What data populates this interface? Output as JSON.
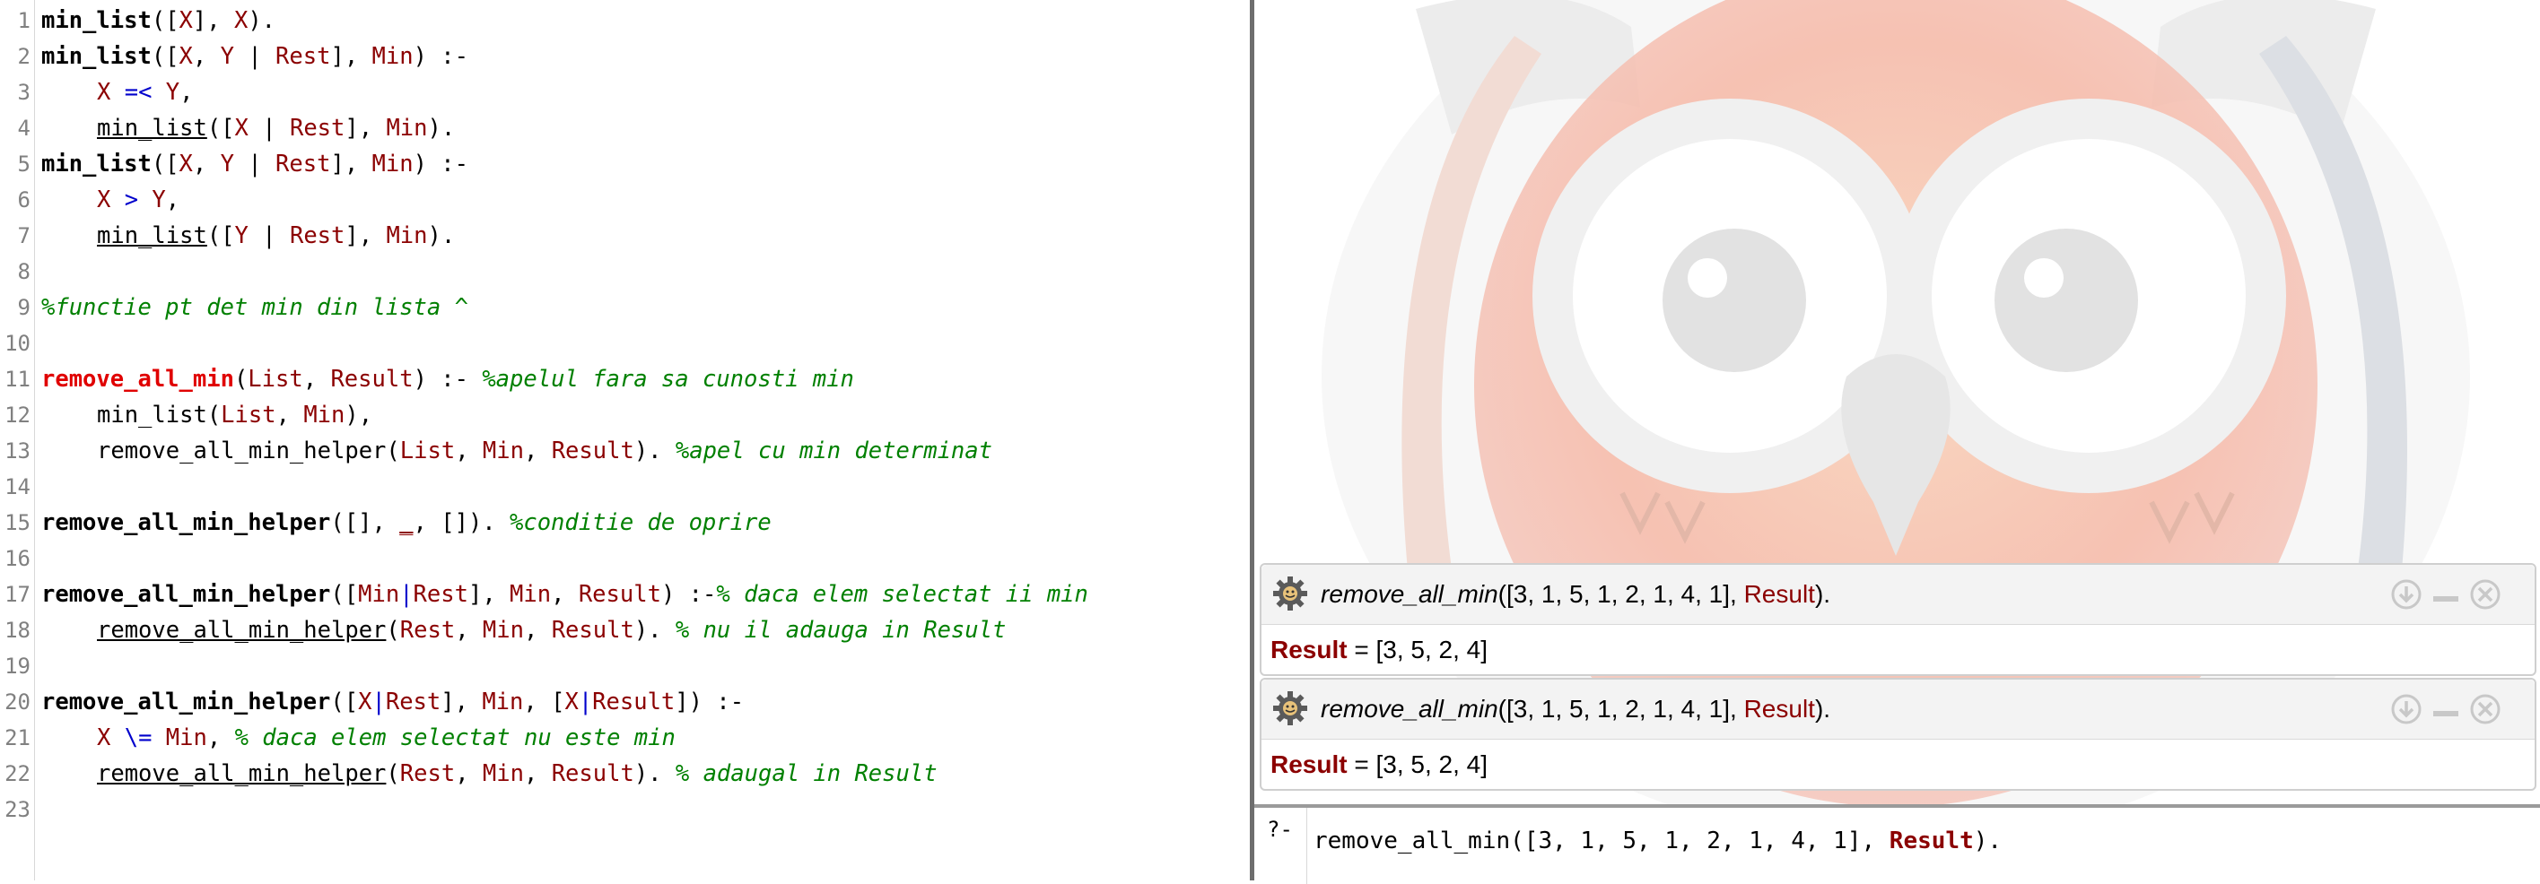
{
  "editor": {
    "line_numbers": [
      "1",
      "2",
      "3",
      "4",
      "5",
      "6",
      "7",
      "8",
      "9",
      "10",
      "11",
      "12",
      "13",
      "14",
      "15",
      "16",
      "17",
      "18",
      "19",
      "20",
      "21",
      "22",
      "23"
    ],
    "lines": {
      "l1": {
        "a": "min_list",
        "b": "([",
        "c": "X",
        "d": "], ",
        "e": "X",
        "f": ")."
      },
      "l2": {
        "a": "min_list",
        "b": "([",
        "c": "X",
        "d": ", ",
        "e": "Y",
        "f": " | ",
        "g": "Rest",
        "h": "], ",
        "i": "Min",
        "j": ") :-"
      },
      "l3": {
        "a": "X",
        "b": " =< ",
        "c": "Y",
        "d": ","
      },
      "l4": {
        "a": "min_list",
        "b": "([",
        "c": "X",
        "d": " | ",
        "e": "Rest",
        "f": "], ",
        "g": "Min",
        "h": ")."
      },
      "l5": {
        "a": "min_list",
        "b": "([",
        "c": "X",
        "d": ", ",
        "e": "Y",
        "f": " | ",
        "g": "Rest",
        "h": "], ",
        "i": "Min",
        "j": ") :-"
      },
      "l6": {
        "a": "X",
        "b": " > ",
        "c": "Y",
        "d": ","
      },
      "l7": {
        "a": "min_list",
        "b": "([",
        "c": "Y",
        "d": " | ",
        "e": "Rest",
        "f": "], ",
        "g": "Min",
        "h": ")."
      },
      "l9": {
        "a": "%functie pt det min din lista ^"
      },
      "l11": {
        "a": "remove_all_min",
        "b": "(",
        "c": "List",
        "d": ", ",
        "e": "Result",
        "f": ") :- ",
        "g": "%apelul fara sa cunosti min"
      },
      "l12": {
        "a": "min_list(",
        "b": "List",
        "c": ", ",
        "d": "Min",
        "e": "),"
      },
      "l13": {
        "a": "remove_all_min_helper(",
        "b": "List",
        "c": ", ",
        "d": "Min",
        "e": ", ",
        "f": "Result",
        "g": "). ",
        "h": "%apel cu min determinat"
      },
      "l15": {
        "a": "remove_all_min_helper",
        "b": "([], ",
        "c": "_",
        "d": ", []). ",
        "e": "%conditie de oprire"
      },
      "l17": {
        "a": "remove_all_min_helper",
        "b": "([",
        "c": "Min",
        "d": "|",
        "e": "Rest",
        "f": "], ",
        "g": "Min",
        "h": ", ",
        "i": "Result",
        "j": ") :-",
        "k": "% daca elem selectat ii min"
      },
      "l18": {
        "a": "remove_all_min_helper",
        "b": "(",
        "c": "Rest",
        "d": ", ",
        "e": "Min",
        "f": ", ",
        "g": "Result",
        "h": "). ",
        "i": "% nu il adauga in Result"
      },
      "l20": {
        "a": "remove_all_min_helper",
        "b": "([",
        "c": "X",
        "d": "|",
        "e": "Rest",
        "f": "], ",
        "g": "Min",
        "h": ", [",
        "i": "X",
        "j": "|",
        "k": "Result",
        "l": "]) :-"
      },
      "l21": {
        "a": "X",
        "b": " \\= ",
        "c": "Min",
        "d": ", ",
        "e": "% daca elem selectat nu este min"
      },
      "l22": {
        "a": "remove_all_min_helper",
        "b": "(",
        "c": "Rest",
        "d": ", ",
        "e": "Min",
        "f": ", ",
        "g": "Result",
        "h": "). ",
        "i": "% adaugal in Result"
      }
    }
  },
  "queries": [
    {
      "pred": "remove_all_min",
      "args": "([3, 1, 5, 1, 2, 1, 4, 1], ",
      "var": "Result",
      "end": ").",
      "answer_var": "Result",
      "answer_rest": " = [3, 5, 2, 4]"
    },
    {
      "pred": "remove_all_min",
      "args": "([3, 1, 5, 1, 2, 1, 4, 1], ",
      "var": "Result",
      "end": ").",
      "answer_var": "Result",
      "answer_rest": " = [3, 5, 2, 4]"
    }
  ],
  "query_icons": [
    "gear-icon",
    "download-icon",
    "minimize-icon",
    "close-icon"
  ],
  "prompt": {
    "mark": "?-",
    "input_before": "remove_all_min([3, 1, 5, 1, 2, 1, 4, 1], ",
    "input_var": "Result",
    "input_after": ")."
  },
  "colors": {
    "head_red": "#e00000",
    "variable": "#8b0000",
    "operator": "#0000cc",
    "comment": "#008000"
  }
}
